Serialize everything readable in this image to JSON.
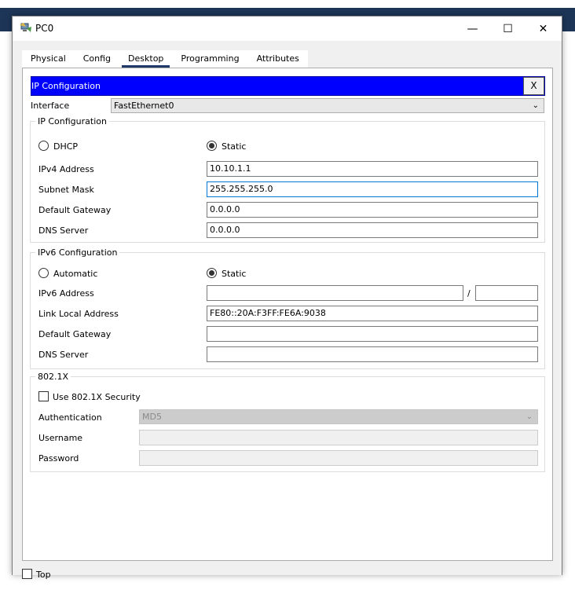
{
  "window": {
    "title": "PC0",
    "minimize": "—",
    "maximize": "☐",
    "close": "✕"
  },
  "tabs": [
    {
      "label": "Physical"
    },
    {
      "label": "Config"
    },
    {
      "label": "Desktop"
    },
    {
      "label": "Programming"
    },
    {
      "label": "Attributes"
    }
  ],
  "active_tab": "Desktop",
  "ip_config": {
    "title": "IP Configuration",
    "close_label": "X",
    "interface_label": "Interface",
    "interface_value": "FastEthernet0",
    "ipv4": {
      "group_title": "IP Configuration",
      "dhcp_label": "DHCP",
      "static_label": "Static",
      "selected": "Static",
      "ipv4_address_label": "IPv4 Address",
      "ipv4_address": "10.10.1.1",
      "subnet_mask_label": "Subnet Mask",
      "subnet_mask": "255.255.255.0",
      "default_gateway_label": "Default Gateway",
      "default_gateway": "0.0.0.0",
      "dns_server_label": "DNS Server",
      "dns_server": "0.0.0.0"
    },
    "ipv6": {
      "group_title": "IPv6 Configuration",
      "automatic_label": "Automatic",
      "static_label": "Static",
      "selected": "Static",
      "ipv6_address_label": "IPv6 Address",
      "ipv6_address": "",
      "prefix_separator": "/",
      "prefix_length": "",
      "link_local_label": "Link Local Address",
      "link_local": "FE80::20A:F3FF:FE6A:9038",
      "default_gateway_label": "Default Gateway",
      "default_gateway": "",
      "dns_server_label": "DNS Server",
      "dns_server": ""
    },
    "dot1x": {
      "group_title": "802.1X",
      "use_security_label": "Use 802.1X Security",
      "use_security_checked": false,
      "authentication_label": "Authentication",
      "authentication_value": "MD5",
      "username_label": "Username",
      "username": "",
      "password_label": "Password",
      "password": ""
    }
  },
  "footer": {
    "top_label": "Top",
    "top_checked": false
  }
}
